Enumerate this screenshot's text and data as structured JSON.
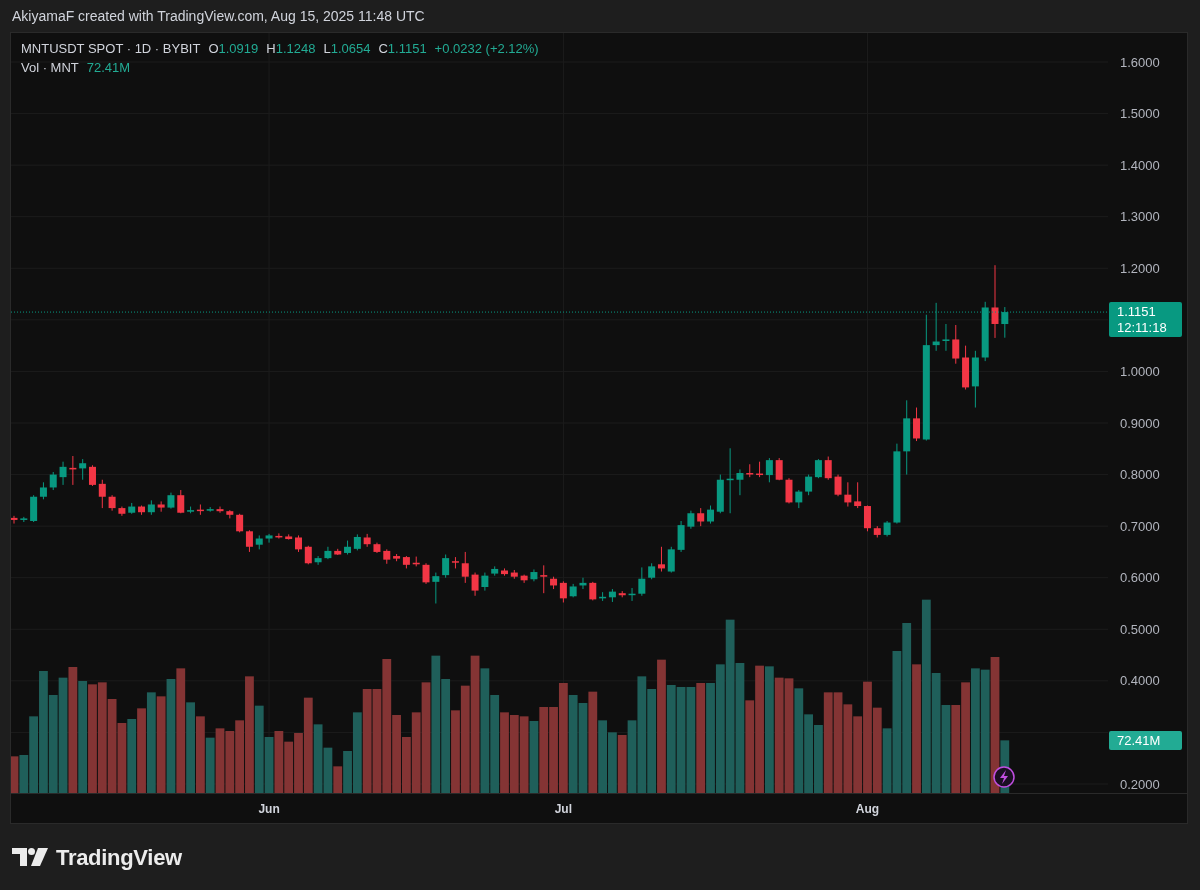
{
  "header": {
    "text": "AkiyamaF created with TradingView.com, Aug 15, 2025 11:48 UTC"
  },
  "chart": {
    "legend": {
      "symbol": "MNTUSDT SPOT · 1D · BYBIT",
      "change": "+0.0232 (+2.12%)",
      "ohlc": [
        {
          "key": "O",
          "value": "1.0919"
        },
        {
          "key": "H",
          "value": "1.1248"
        },
        {
          "key": "L",
          "value": "1.0654"
        },
        {
          "key": "C",
          "value": "1.1151"
        }
      ]
    },
    "volume_legend": {
      "label": "Vol · MNT",
      "value": "72.41M"
    },
    "last_price": {
      "price": "1.1151",
      "countdown": "12:11:18"
    },
    "volume_badge": "72.41M",
    "price_axis": [
      "1.6000",
      "1.5000",
      "1.4000",
      "1.3000",
      "1.2000",
      "1.0000",
      "0.9000",
      "0.8000",
      "0.7000",
      "0.6000",
      "0.5000",
      "0.4000",
      "0.2000"
    ],
    "time_axis": [
      "Jun",
      "Jul",
      "Aug"
    ]
  },
  "logo": {
    "text": "TradingView"
  }
}
